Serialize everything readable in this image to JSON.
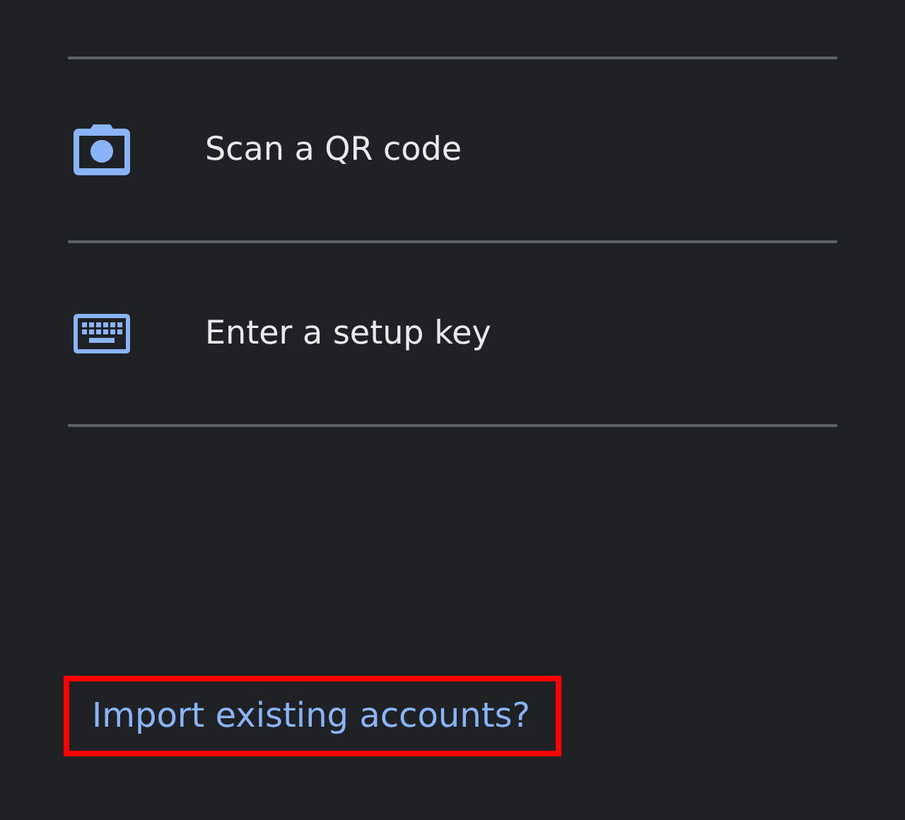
{
  "options": [
    {
      "kind": "camera",
      "label": "Scan a QR code"
    },
    {
      "kind": "keyboard",
      "label": "Enter a setup key"
    }
  ],
  "import_link": {
    "text": "Import existing accounts?",
    "highlighted": true
  }
}
